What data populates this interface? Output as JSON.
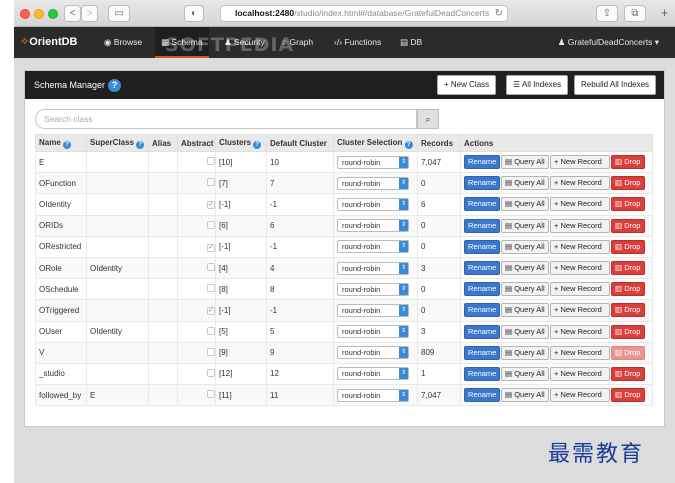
{
  "browser": {
    "url_host": "localhost:2480",
    "url_path": "/studio/index.html#/database/GratefulDeadConcerts",
    "back": "<",
    "forward": ">"
  },
  "nav": {
    "logo": "OrientDB",
    "items": [
      {
        "label": "Browse",
        "icon": "eye-icon"
      },
      {
        "label": "Schema",
        "icon": "table-icon",
        "active": true
      },
      {
        "label": "Security",
        "icon": "user-icon"
      },
      {
        "label": "Graph",
        "icon": "graph-icon"
      },
      {
        "label": "Functions",
        "icon": "code-icon"
      },
      {
        "label": "DB",
        "icon": "database-icon"
      }
    ],
    "user": "GratefulDeadConcerts",
    "watermark": "SOFTPEDIA"
  },
  "schema": {
    "title": "Schema Manager",
    "buttons": {
      "new_class": "New Class",
      "all_indexes": "All Indexes",
      "rebuild": "Rebuild All Indexes"
    },
    "search_placeholder": "Search class",
    "columns": [
      "Name",
      "SuperClass",
      "Alias",
      "Abstract",
      "Clusters",
      "Default Cluster",
      "Cluster Selection",
      "Records",
      "Actions"
    ],
    "actions": {
      "rename": "Rename",
      "query": "Query All",
      "new_record": "New Record",
      "drop": "Drop"
    },
    "rows": [
      {
        "name": "E",
        "superclass": "",
        "abstract": false,
        "clusters": "[10]",
        "default": "10",
        "selection": "round-robin",
        "records": "7,047",
        "drop_dim": false
      },
      {
        "name": "OFunction",
        "superclass": "",
        "abstract": false,
        "clusters": "[7]",
        "default": "7",
        "selection": "round-robin",
        "records": "0",
        "drop_dim": false
      },
      {
        "name": "OIdentity",
        "superclass": "",
        "abstract": true,
        "clusters": "[-1]",
        "default": "-1",
        "selection": "round-robin",
        "records": "6",
        "drop_dim": false
      },
      {
        "name": "ORIDs",
        "superclass": "",
        "abstract": false,
        "clusters": "[6]",
        "default": "6",
        "selection": "round-robin",
        "records": "0",
        "drop_dim": false
      },
      {
        "name": "ORestricted",
        "superclass": "",
        "abstract": true,
        "clusters": "[-1]",
        "default": "-1",
        "selection": "round-robin",
        "records": "0",
        "drop_dim": false
      },
      {
        "name": "ORole",
        "superclass": "OIdentity",
        "abstract": false,
        "clusters": "[4]",
        "default": "4",
        "selection": "round-robin",
        "records": "3",
        "drop_dim": false
      },
      {
        "name": "OSchedule",
        "superclass": "",
        "abstract": false,
        "clusters": "[8]",
        "default": "8",
        "selection": "round-robin",
        "records": "0",
        "drop_dim": false
      },
      {
        "name": "OTriggered",
        "superclass": "",
        "abstract": true,
        "clusters": "[-1]",
        "default": "-1",
        "selection": "round-robin",
        "records": "0",
        "drop_dim": false
      },
      {
        "name": "OUser",
        "superclass": "OIdentity",
        "abstract": false,
        "clusters": "[5]",
        "default": "5",
        "selection": "round-robin",
        "records": "3",
        "drop_dim": false
      },
      {
        "name": "V",
        "superclass": "",
        "abstract": false,
        "clusters": "[9]",
        "default": "9",
        "selection": "round-robin",
        "records": "809",
        "drop_dim": true
      },
      {
        "name": "_studio",
        "superclass": "",
        "abstract": false,
        "clusters": "[12]",
        "default": "12",
        "selection": "round-robin",
        "records": "1",
        "drop_dim": false
      },
      {
        "name": "followed_by",
        "superclass": "E",
        "abstract": false,
        "clusters": "[11]",
        "default": "11",
        "selection": "round-robin",
        "records": "7,047",
        "drop_dim": false
      }
    ]
  },
  "watermark": "最需教育"
}
